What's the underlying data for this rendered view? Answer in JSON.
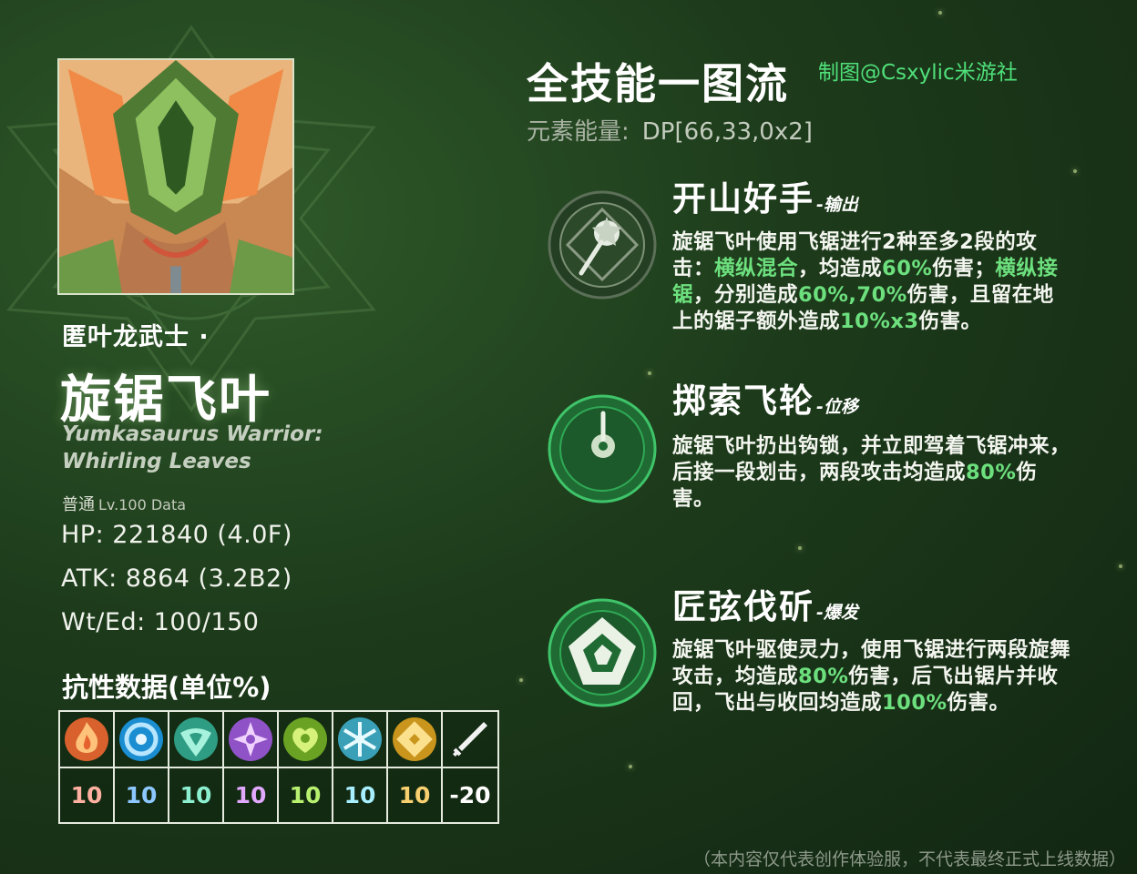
{
  "character": {
    "subtitle": "匿叶龙武士 ·",
    "name": "旋锯飞叶",
    "english_line1": "Yumkasaurus Warrior:",
    "english_line2": "Whirling Leaves",
    "level_prefix": "普通",
    "level_text": "Lv.100 Data",
    "hp": "HP: 221840 (4.0F)",
    "atk": "ATK: 8864 (3.2B2)",
    "wt": "Wt/Ed: 100/150"
  },
  "resistance": {
    "title": "抗性数据(单位%)",
    "items": [
      {
        "icon": "pyro-icon",
        "value": "10",
        "color": "#ffb0a0"
      },
      {
        "icon": "hydro-icon",
        "value": "10",
        "color": "#8cc8ff"
      },
      {
        "icon": "anemo-icon",
        "value": "10",
        "color": "#8cf0d0"
      },
      {
        "icon": "electro-icon",
        "value": "10",
        "color": "#e0a8ff"
      },
      {
        "icon": "dendro-icon",
        "value": "10",
        "color": "#b8f070"
      },
      {
        "icon": "cryo-icon",
        "value": "10",
        "color": "#a8f0ff"
      },
      {
        "icon": "geo-icon",
        "value": "10",
        "color": "#f8d070"
      },
      {
        "icon": "physical-icon",
        "value": "-20",
        "color": "#ffffff"
      }
    ]
  },
  "header": {
    "title": "全技能一图流",
    "credit": "制图@Csxylic米游社",
    "energy_label": "元素能量:",
    "energy_value": "DP[66,33,0x2]"
  },
  "skills": [
    {
      "icon": "saw-blade-icon",
      "name": "开山好手",
      "tag": "-输出",
      "desc": [
        {
          "t": "旋锯飞叶使用飞锯进行2种至多2段的攻击：",
          "h": false
        },
        {
          "t": "横纵混合",
          "h": true
        },
        {
          "t": "，均造成",
          "h": false
        },
        {
          "t": "60%",
          "h": true
        },
        {
          "t": "伤害；",
          "h": false
        },
        {
          "t": "横纵接锯",
          "h": true
        },
        {
          "t": "，分别造成",
          "h": false
        },
        {
          "t": "60%,70%",
          "h": true
        },
        {
          "t": "伤害，且留在地上的锯子额外造成",
          "h": false
        },
        {
          "t": "10%x3",
          "h": true
        },
        {
          "t": "伤害。",
          "h": false
        }
      ]
    },
    {
      "icon": "crescent-hook-icon",
      "name": "掷索飞轮",
      "tag": "-位移",
      "desc": [
        {
          "t": "旋锯飞叶扔出钩锁，并立即驾着飞锯冲来，后接一段划击，两段攻击均造成",
          "h": false
        },
        {
          "t": "80%",
          "h": true
        },
        {
          "t": "伤害。",
          "h": false
        }
      ]
    },
    {
      "icon": "dendro-spiral-icon",
      "name": "匠弦伐斫",
      "tag": "-爆发",
      "desc": [
        {
          "t": "旋锯飞叶驱使灵力，使用飞锯进行两段旋舞攻击，均造成",
          "h": false
        },
        {
          "t": "80%",
          "h": true
        },
        {
          "t": "伤害，后飞出锯片并收回，飞出与收回均造成",
          "h": false
        },
        {
          "t": "100%",
          "h": true
        },
        {
          "t": "伤害。",
          "h": false
        }
      ]
    }
  ],
  "footer_note": "（本内容仅代表创作体验服，不代表最终正式上线数据）",
  "colors": {
    "highlight": "#6de07e",
    "credit": "#4fe07a"
  }
}
